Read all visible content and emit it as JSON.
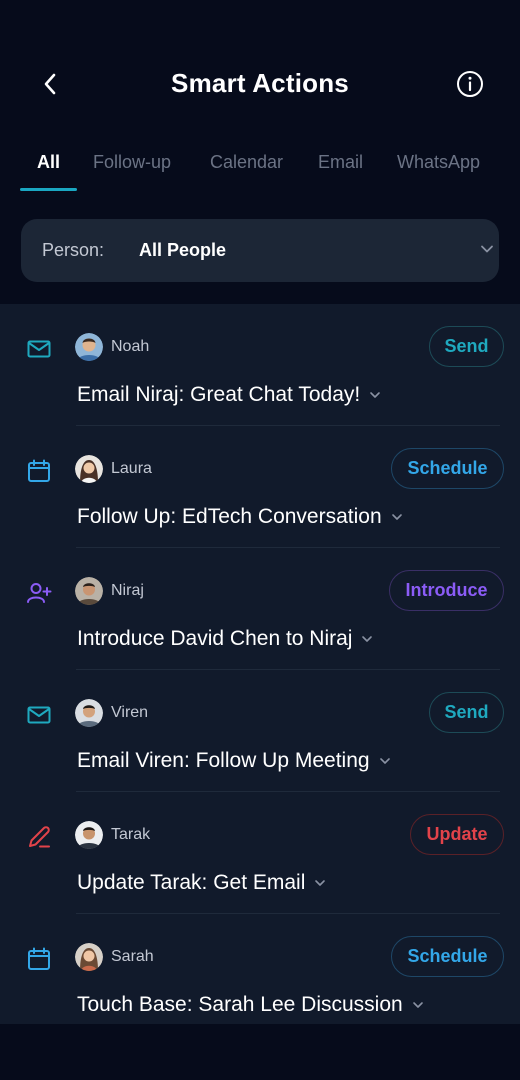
{
  "header": {
    "title": "Smart Actions",
    "back_icon": "chevron-left-icon",
    "info_icon": "info-icon"
  },
  "tabs": [
    {
      "label": "All",
      "active": true
    },
    {
      "label": "Follow-up",
      "active": false
    },
    {
      "label": "Calendar",
      "active": false
    },
    {
      "label": "Email",
      "active": false
    },
    {
      "label": "WhatsApp",
      "active": false
    }
  ],
  "filter": {
    "label": "Person:",
    "value": "All People",
    "icon": "chevron-down-icon"
  },
  "colors": {
    "background": "#060b1b",
    "list_background": "#111a2b",
    "accent_teal": "#1aa7c2",
    "send": "#1fa9bf",
    "schedule": "#33a7e8",
    "introduce": "#8b5cf6",
    "update": "#e2434a"
  },
  "actions": [
    {
      "icon": "mail-icon",
      "person": "Noah",
      "button": "Send",
      "title": "Email Niraj: Great Chat Today!",
      "color": "#1fa9bf"
    },
    {
      "icon": "calendar-icon",
      "person": "Laura",
      "button": "Schedule",
      "title": "Follow Up: EdTech Conversation",
      "color": "#33a7e8"
    },
    {
      "icon": "user-plus-icon",
      "person": "Niraj",
      "button": "Introduce",
      "title": "Introduce David Chen to Niraj",
      "color": "#8b5cf6"
    },
    {
      "icon": "mail-icon",
      "person": "Viren",
      "button": "Send",
      "title": "Email Viren: Follow Up Meeting",
      "color": "#1fa9bf"
    },
    {
      "icon": "pencil-icon",
      "person": "Tarak",
      "button": "Update",
      "title": "Update Tarak: Get Email",
      "color": "#e2434a"
    },
    {
      "icon": "calendar-icon",
      "person": "Sarah",
      "button": "Schedule",
      "title": "Touch Base: Sarah Lee Discussion",
      "color": "#33a7e8"
    }
  ]
}
